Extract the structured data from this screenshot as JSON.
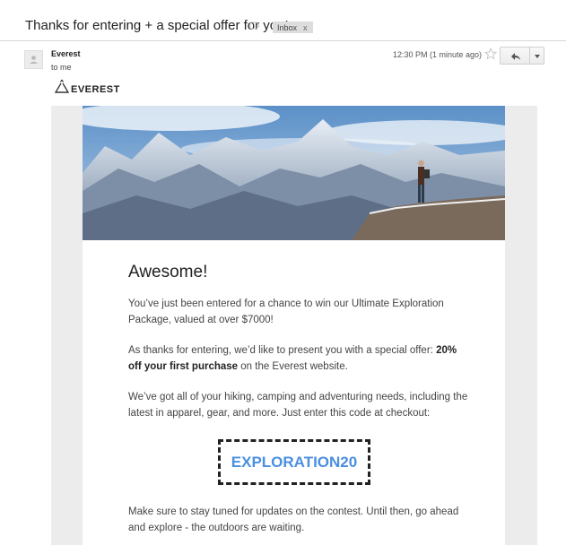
{
  "message": {
    "subject": "Thanks for entering + a special offer for you!",
    "label": "Inbox",
    "label_remove": "x",
    "sender": "Everest",
    "recipient": "to me",
    "timestamp": "12:30 PM (1 minute ago)"
  },
  "icons": {
    "tag": "tag-icon",
    "avatar": "avatar-icon",
    "star": "star-icon",
    "reply": "reply-icon",
    "more": "chevron-down-icon",
    "brand": "mountain-logo-icon"
  },
  "email": {
    "brand_name": "EVEREST",
    "headline": "Awesome!",
    "para1": "You’ve just been entered for a chance to win our Ultimate Exploration Package, valued at over $7000!",
    "para2_before": "As thanks for entering, we’d like to present you with a special offer: ",
    "para2_bold": "20% off your first purchase",
    "para2_after": " on the Everest website.",
    "para3": "We’ve got all of your hiking, camping and adventuring needs, including the latest in apparel, gear, and more. Just enter this code at checkout:",
    "promo_code": "EXPLORATION20",
    "para4": "Make sure to stay tuned for updates on the contest. Until then, go ahead and explore - the outdoors are waiting."
  },
  "colors": {
    "promo_code": "#4a8fe0",
    "email_background": "#ececec",
    "label_background": "#dddddd"
  }
}
